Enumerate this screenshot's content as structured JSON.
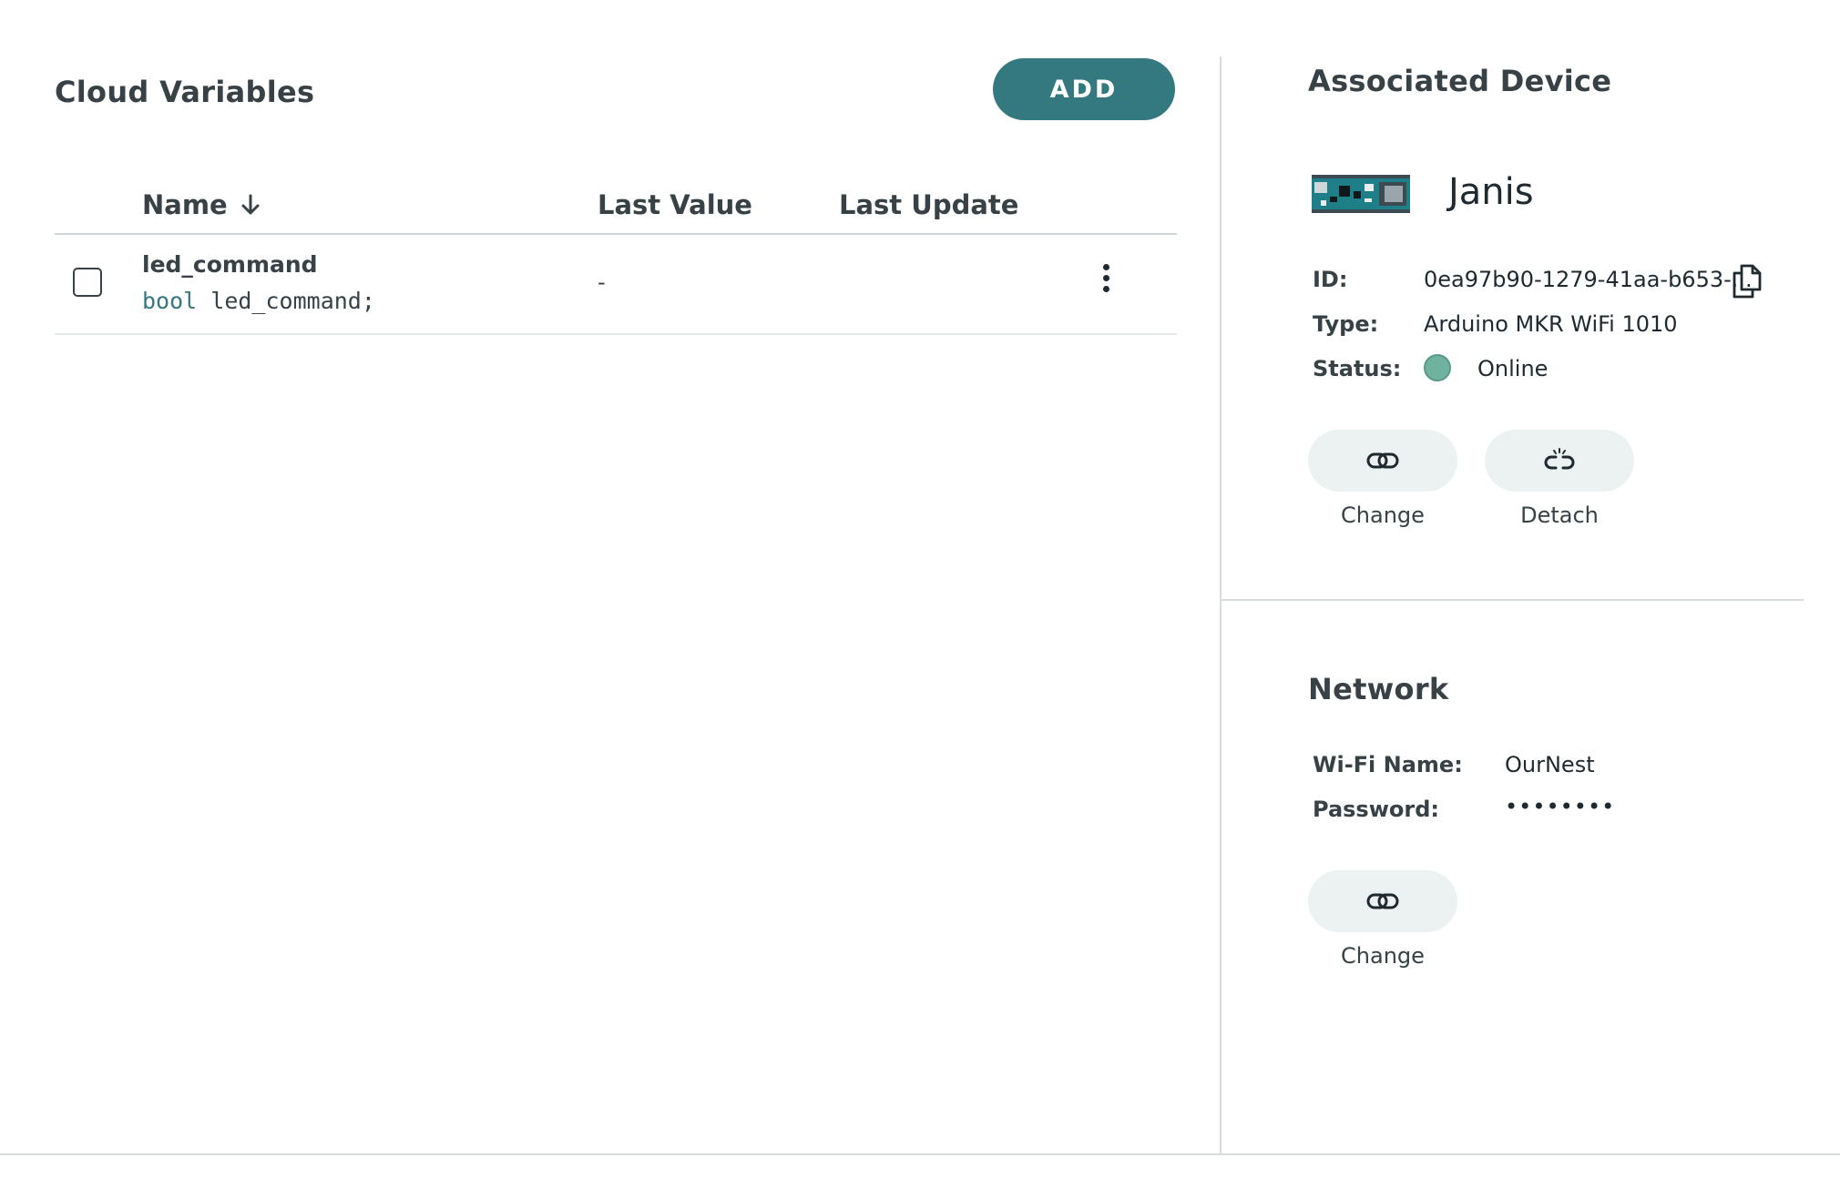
{
  "cloud_variables": {
    "title": "Cloud Variables",
    "add_label": "ADD",
    "columns": {
      "name": "Name",
      "last_value": "Last Value",
      "last_update": "Last Update"
    },
    "rows": [
      {
        "name": "led_command",
        "decl_type": "bool",
        "decl_rest": "led_command;",
        "last_value": "-",
        "last_update": ""
      }
    ]
  },
  "associated_device": {
    "title": "Associated Device",
    "device_name": "Janis",
    "id_label": "ID:",
    "id_value": "0ea97b90-1279-41aa-b653-...",
    "type_label": "Type:",
    "type_value": "Arduino MKR WiFi 1010",
    "status_label": "Status:",
    "status_value": "Online",
    "status_color": "#6fb39e",
    "change_label": "Change",
    "detach_label": "Detach"
  },
  "network": {
    "title": "Network",
    "wifi_label": "Wi-Fi Name:",
    "wifi_value": "OurNest",
    "password_label": "Password:",
    "password_value": "••••••••",
    "change_label": "Change"
  },
  "colors": {
    "accent": "#33797f",
    "text": "#374146",
    "pill_bg": "#ecf1f1"
  },
  "icons": {
    "sort": "arrow-down-icon",
    "row_menu": "kebab-menu-icon",
    "copy": "copy-icon",
    "change": "link-icon",
    "detach": "unlink-icon"
  }
}
